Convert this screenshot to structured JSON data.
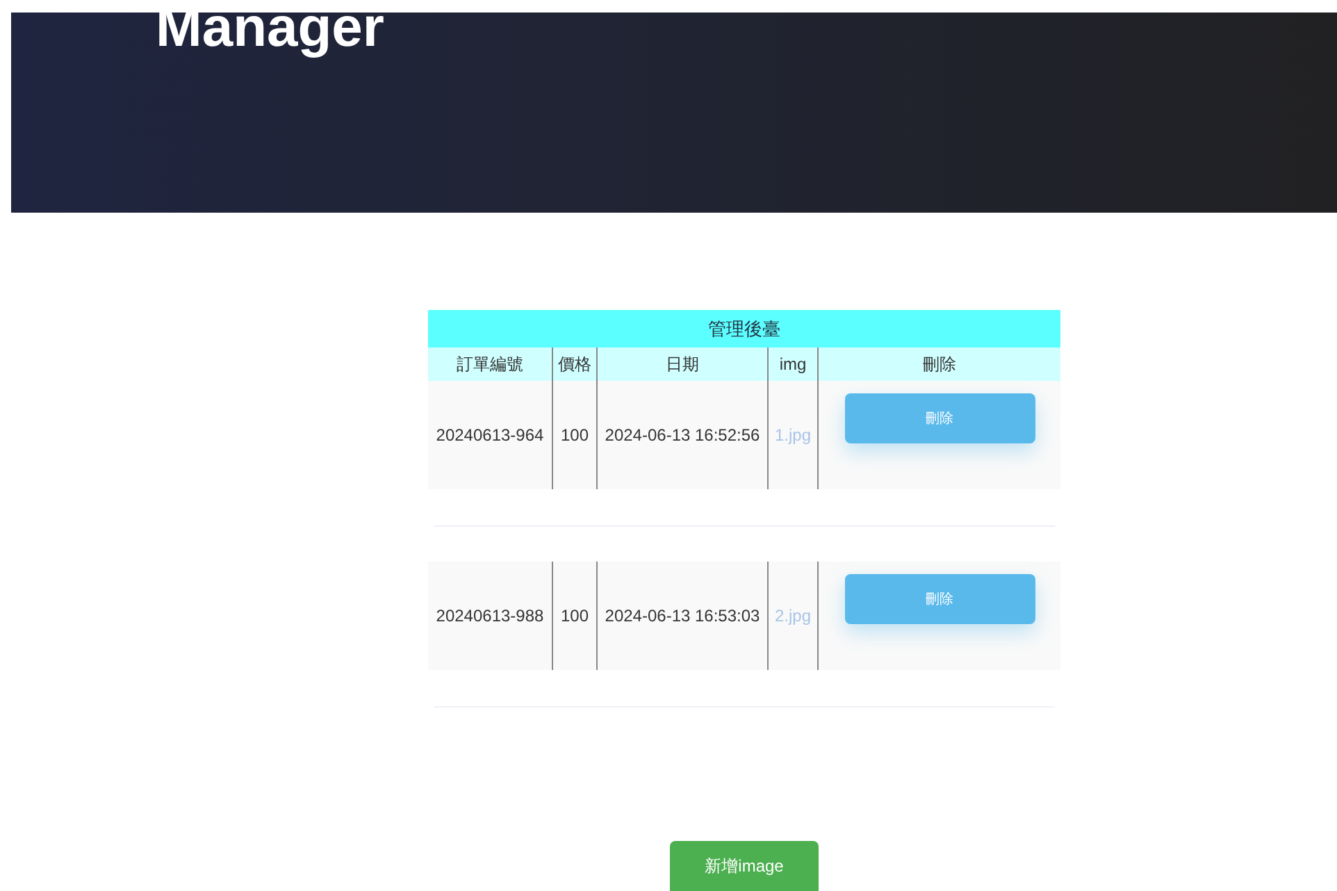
{
  "header": {
    "title": "Manager"
  },
  "table": {
    "caption": "管理後臺",
    "columns": [
      "訂單編號",
      "價格",
      "日期",
      "img",
      "刪除"
    ],
    "rows": [
      {
        "order_no": "20240613-964",
        "price": "100",
        "date": "2024-06-13 16:52:56",
        "img": "1.jpg",
        "action": "刪除"
      },
      {
        "order_no": "20240613-988",
        "price": "100",
        "date": "2024-06-13 16:53:03",
        "img": "2.jpg",
        "action": "刪除"
      }
    ]
  },
  "add_button": "新增image"
}
